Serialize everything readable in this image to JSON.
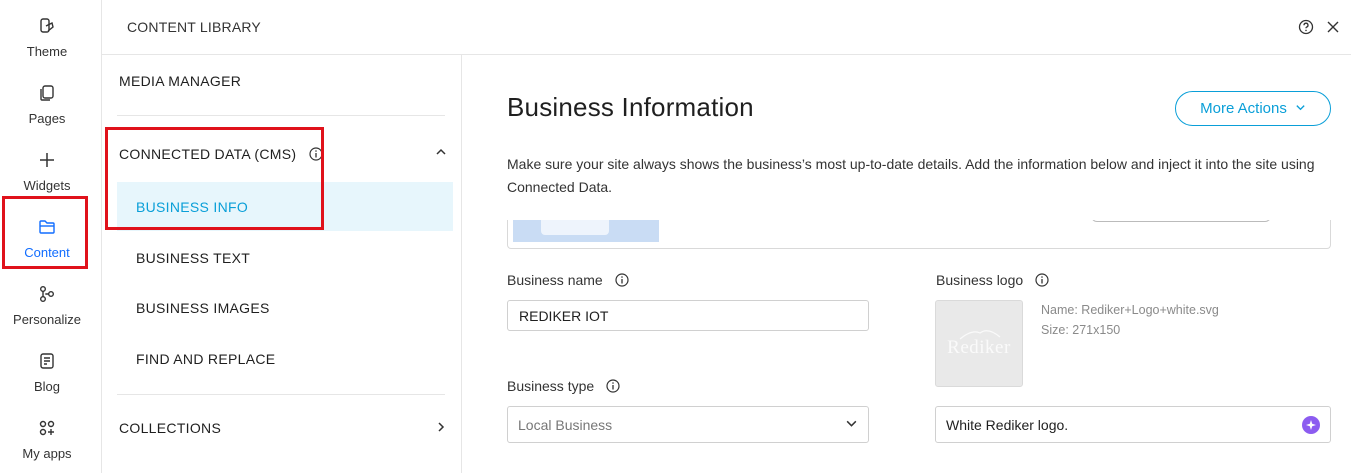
{
  "rail": {
    "items": [
      {
        "label": "Theme",
        "icon": "theme-icon"
      },
      {
        "label": "Pages",
        "icon": "pages-icon"
      },
      {
        "label": "Widgets",
        "icon": "plus-icon"
      },
      {
        "label": "Content",
        "icon": "folder-icon",
        "active": true
      },
      {
        "label": "Personalize",
        "icon": "personalize-icon"
      },
      {
        "label": "Blog",
        "icon": "blog-icon"
      },
      {
        "label": "My apps",
        "icon": "apps-icon"
      }
    ]
  },
  "topbar": {
    "title": "CONTENT LIBRARY",
    "help_icon": "help-circle-icon",
    "close_icon": "close-icon"
  },
  "library_nav": {
    "media_manager": "MEDIA MANAGER",
    "connected_data": "CONNECTED DATA (CMS)",
    "sub_items": [
      "BUSINESS INFO",
      "BUSINESS TEXT",
      "BUSINESS IMAGES",
      "FIND AND REPLACE"
    ],
    "selected_sub_item": "BUSINESS INFO",
    "collections": "COLLECTIONS"
  },
  "main": {
    "title": "Business Information",
    "more_actions": "More Actions",
    "description": "Make sure your site always shows the business’s most up-to-date details. Add the information below and inject it into the site using Connected Data.",
    "business_name_label": "Business name",
    "business_name_value": "REDIKER IOT",
    "business_type_label": "Business type",
    "business_type_value": "Local Business",
    "business_logo_label": "Business logo",
    "logo_name": "Name: Rediker+Logo+white.svg",
    "logo_size": "Size: 271x150",
    "logo_image_text": "Rediker",
    "logo_alt_text": "White Rediker logo."
  },
  "colors": {
    "accent": "#0a9fd8",
    "active_rail": "#116dff",
    "highlight_box": "#e0121b",
    "selected_bg": "#e7f6fc",
    "ai_purple": "#8c5cf0"
  }
}
